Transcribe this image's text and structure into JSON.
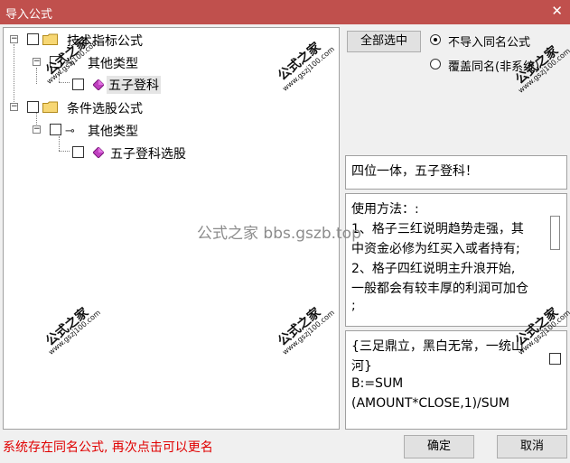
{
  "window": {
    "title": "导入公式",
    "close_glyph": "✕"
  },
  "tree": {
    "nodes": [
      {
        "label": "技术指标公式"
      },
      {
        "label": "其他类型"
      },
      {
        "label": "五子登科"
      },
      {
        "label": "条件选股公式"
      },
      {
        "label": "其他类型"
      },
      {
        "label": "五子登科选股"
      }
    ],
    "expander_glyph": "−"
  },
  "watermarks": {
    "cn": "公式之家",
    "url": "www.gszj100.com",
    "center": "公式之家 bbs.gszb.top"
  },
  "options": {
    "select_all": "全部选中",
    "radio_skip": "不导入同名公式",
    "radio_overwrite": "覆盖同名(非系统)",
    "selected": "radio_skip"
  },
  "description": "四位一体，五子登科！",
  "usage": [
    "使用方法：:",
    "1、格子三红说明趋势走强，其",
    "中资金必修为红买入或者持有;",
    "2、格子四红说明主升浪开始,",
    "一般都会有较丰厚的利润可加仓",
    ";"
  ],
  "formula": [
    "{三足鼎立，黑白无常，一统山",
    "河}",
    "B:=SUM",
    "(AMOUNT*CLOSE,1)/SUM"
  ],
  "status": "系统存在同名公式, 再次点击可以更名",
  "buttons": {
    "ok": "确定",
    "cancel": "取消"
  }
}
